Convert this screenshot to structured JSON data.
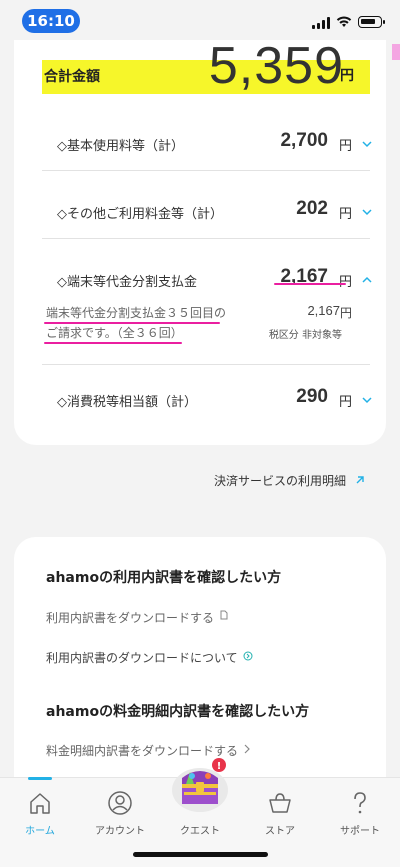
{
  "status_bar": {
    "time": "16:10"
  },
  "summary": {
    "total_label": "合計金額",
    "total_amount": "5,359",
    "yen": "円",
    "highlight_color": "#f6f62a"
  },
  "breakdown": [
    {
      "label": "◇基本使用料等（計）",
      "amount": "2,700",
      "yen": "円"
    },
    {
      "label": "◇その他ご利用料金等（計）",
      "amount": "202",
      "yen": "円"
    },
    {
      "label": "◇端末等代金分割支払金",
      "amount": "2,167",
      "yen": "円"
    },
    {
      "label": "◇消費税等相当額（計）",
      "amount": "290",
      "yen": "円"
    }
  ],
  "installment_detail": {
    "note_line1": "端末等代金分割支払金３５回目の",
    "note_line2": "ご請求です。（全３６回）",
    "amount": "2,167",
    "yen": "円",
    "tax_note": "税区分 非対象等"
  },
  "payment_link": "決済サービスの利用明細",
  "ahamo_usage": {
    "title": "ahamoの利用内訳書を確認したい方",
    "download": "利用内訳書をダウンロードする",
    "about": "利用内訳書のダウンロードについて"
  },
  "ahamo_bill": {
    "title": "ahamoの料金明細内訳書を確認したい方",
    "download": "料金明細内訳書をダウンロードする"
  },
  "tabbar": {
    "items": [
      {
        "label": "ホーム",
        "icon": "home-icon",
        "active": true
      },
      {
        "label": "アカウント",
        "icon": "account-icon",
        "active": false
      },
      {
        "label": "クエスト",
        "icon": "treasure-chest-icon",
        "active": false
      },
      {
        "label": "ストア",
        "icon": "basket-icon",
        "active": false
      },
      {
        "label": "サポート",
        "icon": "question-icon",
        "active": false
      }
    ],
    "quest_badge": "!"
  },
  "colors": {
    "accent": "#22b1e6",
    "underline": "#ea1fa0",
    "time_pill": "#1f6fe6"
  }
}
